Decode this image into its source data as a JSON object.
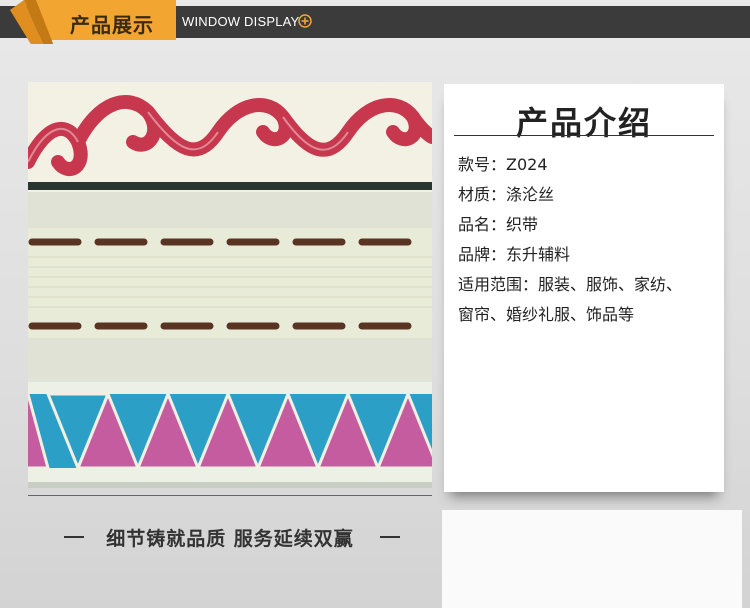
{
  "header": {
    "title": "产品展示",
    "subtitle": "WINDOW DISPLAY"
  },
  "product_image": {
    "description_icon": "woven-ribbon-samples"
  },
  "info": {
    "title": "产品介绍",
    "lines": [
      "款号：Z024",
      "材质：涤沦丝",
      "品名：织带",
      "品牌：东升辅料",
      "适用范围：服装、服饰、家纺、",
      "窗帘、婚纱礼服、饰品等"
    ]
  },
  "slogan": "细节铸就品质 服务延续双赢",
  "colors": {
    "header_bar": "#3b3b3b",
    "tab_orange": "#f2a531",
    "tab_fold": "#c47a14",
    "ribbon_red": "#c7384f",
    "ribbon_brown": "#5a3423",
    "ribbon_blue": "#2b9fc6",
    "ribbon_pink": "#c55c9f"
  }
}
